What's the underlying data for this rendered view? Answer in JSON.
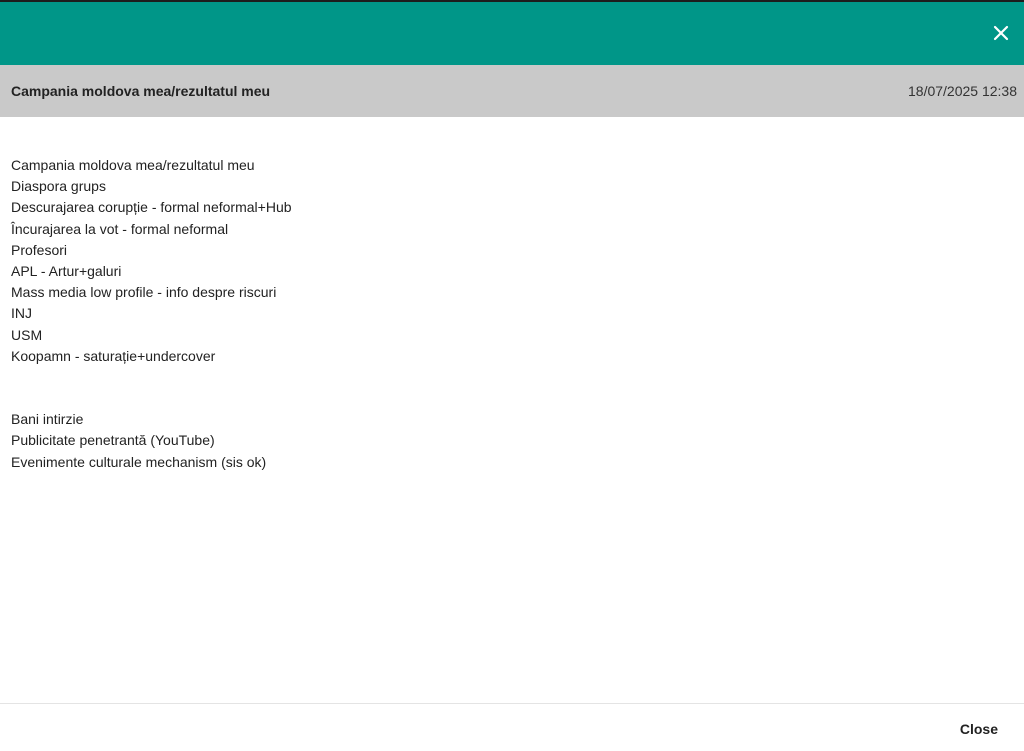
{
  "dialog": {
    "close_icon": "close-icon",
    "header_color": "#009688"
  },
  "note": {
    "title": "Campania moldova mea/rezultatul meu",
    "datetime": "18/07/2025 12:38",
    "lines": [
      "Campania moldova mea/rezultatul meu",
      "Diaspora grups",
      "Descurajarea corupție - formal neformal+Hub",
      "Încurajarea la vot - formal neformal",
      "Profesori",
      "APL - Artur+galuri",
      "Mass media low profile - info despre riscuri",
      "INJ",
      "USM",
      "Koopamn - saturație+undercover",
      "",
      "",
      "Bani intirzie",
      "Publicitate penetrantă (YouTube)",
      "Evenimente culturale mechanism (sis ok)"
    ]
  },
  "footer": {
    "close_label": "Close"
  }
}
